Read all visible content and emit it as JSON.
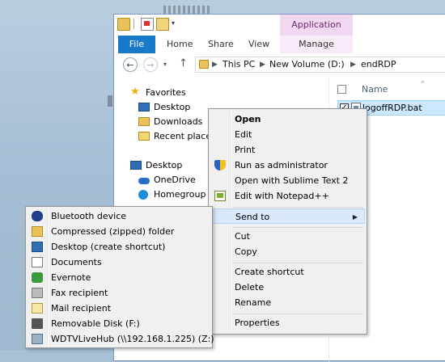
{
  "window": {
    "context_tab_header": "Application Tools",
    "tabs": [
      "File",
      "Home",
      "Share",
      "View",
      "Manage"
    ]
  },
  "address": {
    "crumbs": [
      "This PC",
      "New Volume (D:)",
      "endRDP"
    ]
  },
  "navpane": {
    "items": [
      "Favorites",
      "Desktop",
      "Downloads",
      "Recent places",
      "Desktop",
      "OneDrive",
      "Homegroup"
    ]
  },
  "filepane": {
    "column_name": "Name",
    "file_name": "logoffRDP.bat"
  },
  "context_menu": {
    "items": [
      "Open",
      "Edit",
      "Print",
      "Run as administrator",
      "Open with Sublime Text 2",
      "Edit with Notepad++",
      "Send to",
      "Cut",
      "Copy",
      "Create shortcut",
      "Delete",
      "Rename",
      "Properties"
    ]
  },
  "sendto_menu": {
    "items": [
      "Bluetooth device",
      "Compressed (zipped) folder",
      "Desktop (create shortcut)",
      "Documents",
      "Evernote",
      "Fax recipient",
      "Mail recipient",
      "Removable Disk (F:)",
      "WDTVLiveHub (\\\\192.168.1.225) (Z:)"
    ]
  },
  "icons": {
    "back": "back-arrow-icon",
    "forward": "forward-arrow-icon",
    "up": "up-arrow-icon",
    "submenu": "submenu-arrow-icon"
  },
  "colors": {
    "file_tab": "#1979ca",
    "context_tab": "#f1d8f0",
    "selection": "#cce8ff",
    "menu_bg": "#f0f0f0",
    "menu_hover": "#d9e8fa"
  }
}
